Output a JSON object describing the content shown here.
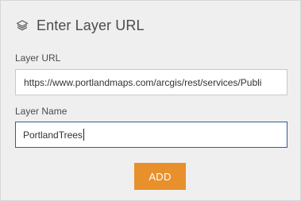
{
  "header": {
    "icon": "layers-icon",
    "title": "Enter Layer URL"
  },
  "layer_url": {
    "label": "Layer URL",
    "value": "https://www.portlandmaps.com/arcgis/rest/services/Publi"
  },
  "layer_name": {
    "label": "Layer Name",
    "value": "PortlandTrees"
  },
  "add_button": {
    "label": "ADD"
  },
  "colors": {
    "accent": "#e8902c",
    "focus_border": "#2f5f94",
    "panel_bg": "#efefef"
  }
}
